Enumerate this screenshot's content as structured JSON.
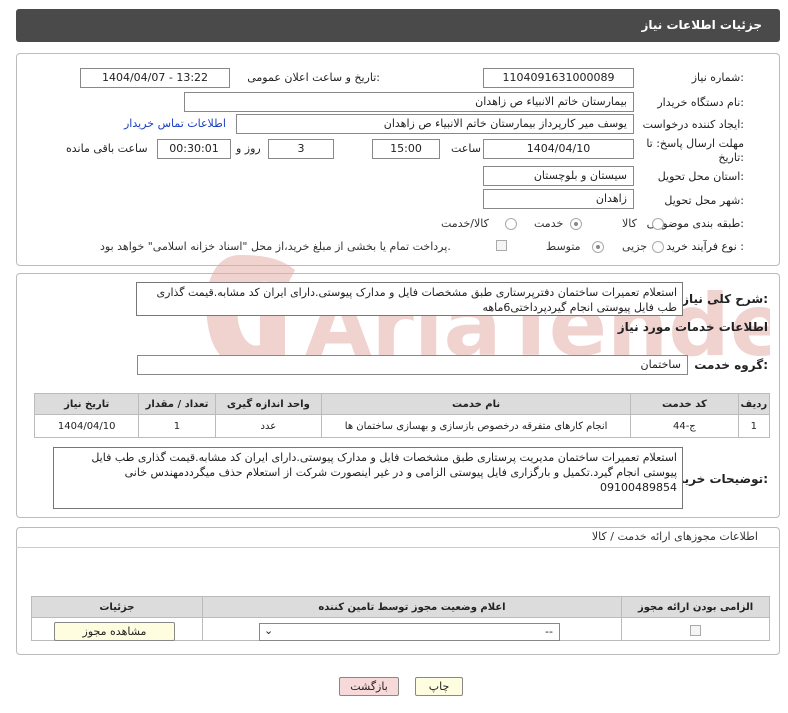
{
  "header": {
    "title": "جزئیات اطلاعات نیاز"
  },
  "fields": {
    "need_number_label": "شماره نیاز:",
    "need_number": "1104091631000089",
    "announce_label": "تاریخ و ساعت اعلان عمومی:",
    "announce_value": "1404/04/07 - 13:22",
    "buyer_label": "نام دستگاه خریدار:",
    "buyer_value": "بیمارستان خاتم الانبیاء  ص  زاهدان",
    "creator_label": "ایجاد کننده درخواست:",
    "creator_value": "یوسف میر کارپرداز بیمارستان خاتم الانبیاء  ص  زاهدان",
    "contact_link": "اطلاعات تماس خریدار",
    "deadline_label": "مهلت ارسال پاسخ: تا تاریخ:",
    "deadline_date": "1404/04/10",
    "time_label": "ساعت",
    "deadline_time": "15:00",
    "days_value": "3",
    "days_label": "روز و",
    "remaining_value": "00:30:01",
    "remaining_label": "ساعت باقی مانده",
    "province_label": "استان محل تحویل:",
    "province_value": "سیستان و بلوچستان",
    "city_label": "شهر محل تحویل:",
    "city_value": "زاهدان",
    "category_label": "طبقه بندی موضوعی:",
    "category_options": [
      "کالا",
      "خدمت",
      "کالا/خدمت"
    ],
    "process_label": "نوع فرآیند خرید :",
    "process_options": [
      "جزیی",
      "متوسط"
    ],
    "payment_note": "پرداخت تمام یا بخشی از مبلغ خرید،از محل \"اسناد خزانه اسلامی\" خواهد بود."
  },
  "summary": {
    "label": "شرح کلی نیاز:",
    "text": "استعلام تعمیرات ساختمان دفترپرستاری طبق مشخصات فایل و مدارک پیوستی.دارای ایران کد مشابه.قیمت گذاری طب فایل پیوستی انجام گیردپرداختی6ماهه"
  },
  "services": {
    "title": "اطلاعات خدمات مورد نیاز",
    "group_label": "گروه خدمت:",
    "group_value": "ساختمان",
    "columns": [
      "ردیف",
      "کد خدمت",
      "نام خدمت",
      "واحد اندازه گیری",
      "تعداد / مقدار",
      "تاریخ نیاز"
    ],
    "rows": [
      {
        "idx": "1",
        "code": "ج-44",
        "name": "انجام کارهای متفرقه درخصوص بازسازی و بهسازی ساختمان ها",
        "unit": "عدد",
        "qty": "1",
        "date": "1404/04/10"
      }
    ]
  },
  "buyer_notes": {
    "label": "توضیحات خریدار:",
    "text": "استعلام تعمیرات ساختمان مدیریت پرستاری طبق مشخصات فایل و مدارک پیوستی.دارای ایران کد مشابه.قیمت گذاری طب فایل پیوستی انجام گیرد.تکمیل و بارگزاری فایل پیوستی الزامی و در غیر اینصورت شرکت از استعلام حذف میگرددمهندس خانی 09100489854"
  },
  "permits": {
    "title": "اطلاعات مجوزهای ارائه خدمت / کالا",
    "columns": [
      "الزامی بودن ارائه مجوز",
      "اعلام وضعیت مجوز توسط تامین کننده",
      "جزئیات"
    ],
    "select_value": "--",
    "view_button": "مشاهده مجوز"
  },
  "footer": {
    "print": "چاپ",
    "back": "بازگشت"
  },
  "watermark_text": "AriaTender.neT",
  "colors": {
    "header_bg": "#4a4a4a",
    "link": "#1a3fbf",
    "back_btn": "#f7d9d9",
    "print_btn": "#fffde0"
  }
}
